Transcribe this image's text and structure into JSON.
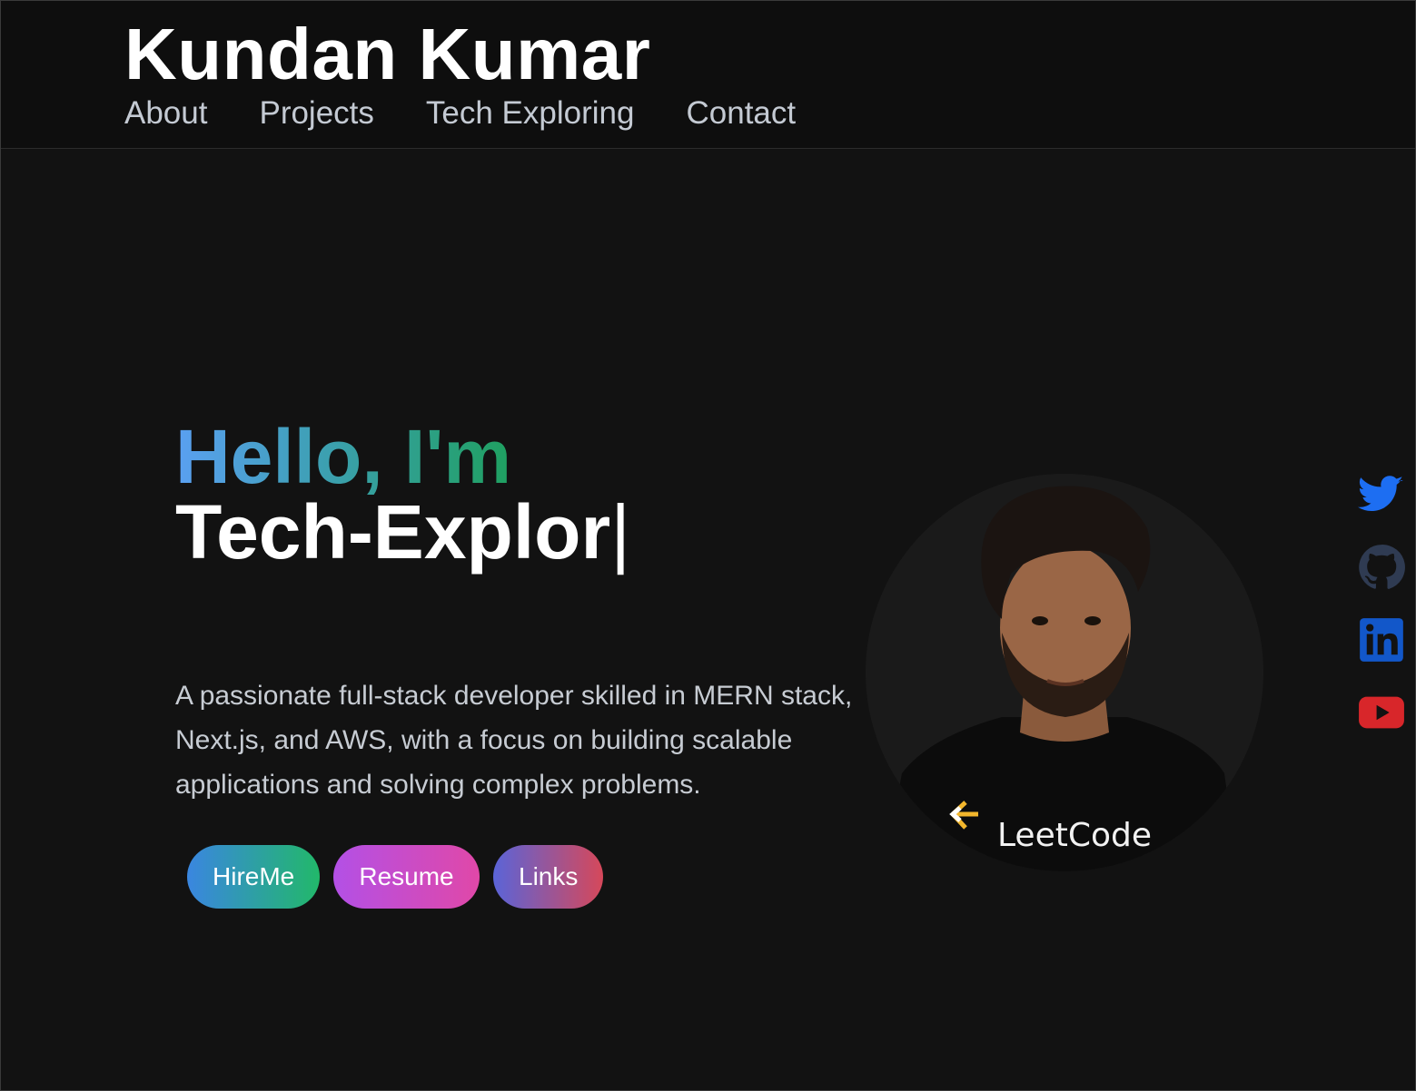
{
  "header": {
    "brand": "Kundan Kumar",
    "nav": [
      "About",
      "Projects",
      "Tech Exploring",
      "Contact"
    ]
  },
  "hero": {
    "greeting": "Hello, I'm",
    "typed_text": "Tech-Explor",
    "cursor": "|",
    "bio_lines": [
      "A passionate full-stack developer skilled in MERN stack,",
      "Next.js, and AWS, with a focus on building scalable",
      "applications and solving complex problems."
    ],
    "buttons": [
      "HireMe",
      "Resume",
      "Links"
    ],
    "avatar_shirt_text": "LeetCode"
  },
  "socials": [
    {
      "icon": "twitter-icon",
      "color": "#1d6ef2"
    },
    {
      "icon": "github-icon",
      "color": "#2f3b52"
    },
    {
      "icon": "linkedin-icon",
      "color": "#1257c9"
    },
    {
      "icon": "youtube-icon",
      "color": "#d8262a"
    }
  ],
  "colors": {
    "background": "#121212",
    "greeting_gradient": [
      "#5aa0f2",
      "#1fa060"
    ]
  }
}
